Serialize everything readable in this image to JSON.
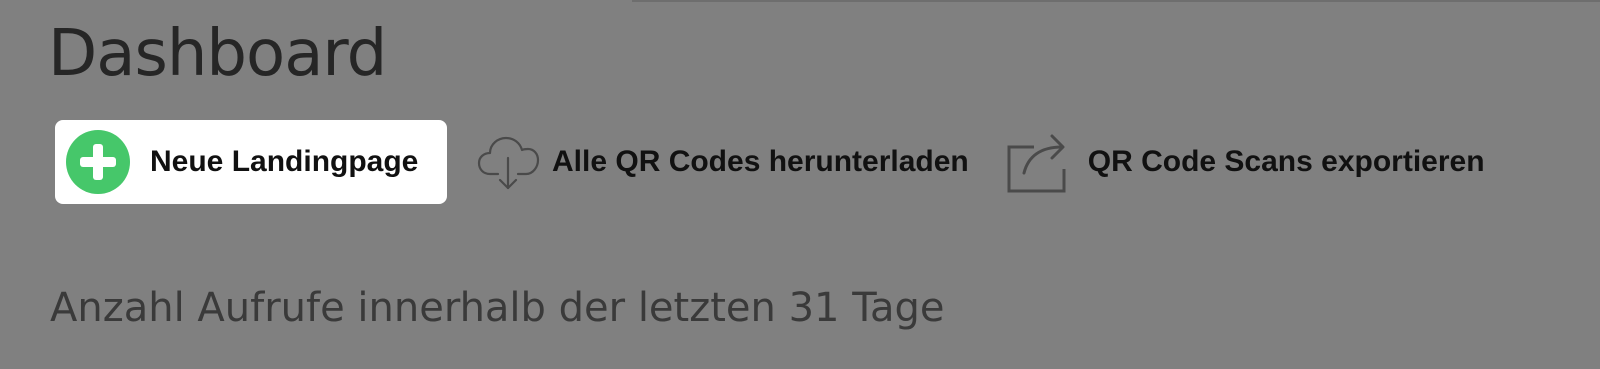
{
  "page": {
    "title": "Dashboard",
    "background_color": "#808080"
  },
  "actions": {
    "new_landingpage": {
      "label": "Neue Landingpage",
      "icon": "plus-circle-icon",
      "icon_color": "#46c76a"
    },
    "download_qr_codes": {
      "label": "Alle QR Codes herunterladen",
      "icon": "cloud-download-icon"
    },
    "export_scans": {
      "label": "QR Code Scans exportieren",
      "icon": "share-export-icon"
    }
  },
  "stats": {
    "heading": "Anzahl Aufrufe innerhalb der letzten 31 Tage"
  }
}
